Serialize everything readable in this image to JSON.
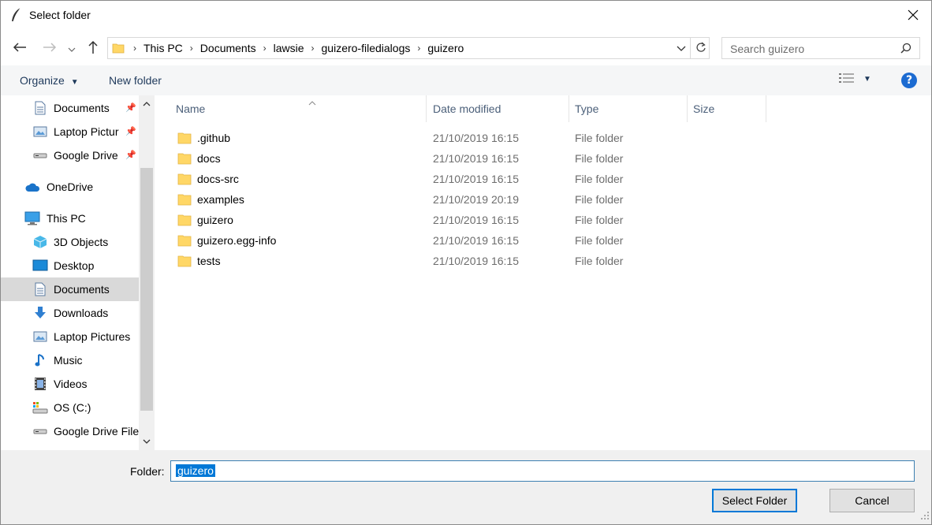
{
  "window": {
    "title": "Select folder",
    "close_glyph": "✕"
  },
  "nav": {
    "breadcrumbs": [
      "This PC",
      "Documents",
      "lawsie",
      "guizero-filedialogs",
      "guizero"
    ],
    "search_placeholder": "Search guizero"
  },
  "toolbar": {
    "organize_label": "Organize",
    "new_folder_label": "New folder",
    "help_label": "?"
  },
  "sidebar": {
    "items": [
      {
        "label": "Documents",
        "icon": "documents-icon",
        "pinned": true
      },
      {
        "label": "Laptop Pictur",
        "icon": "pictures-icon",
        "pinned": true
      },
      {
        "label": "Google Drive",
        "icon": "drive-icon",
        "pinned": true
      },
      {
        "label": "OneDrive",
        "icon": "onedrive-icon"
      },
      {
        "label": "This PC",
        "icon": "this-pc-icon"
      },
      {
        "label": "3D Objects",
        "icon": "3d-objects-icon"
      },
      {
        "label": "Desktop",
        "icon": "desktop-icon"
      },
      {
        "label": "Documents",
        "icon": "documents-icon",
        "selected": true
      },
      {
        "label": "Downloads",
        "icon": "downloads-icon"
      },
      {
        "label": "Laptop Pictures",
        "icon": "pictures-icon"
      },
      {
        "label": "Music",
        "icon": "music-icon"
      },
      {
        "label": "Videos",
        "icon": "videos-icon"
      },
      {
        "label": "OS (C:)",
        "icon": "drive-c-icon"
      },
      {
        "label": "Google Drive File",
        "icon": "drive-icon"
      }
    ]
  },
  "columns": {
    "name": "Name",
    "date": "Date modified",
    "type": "Type",
    "size": "Size"
  },
  "files": [
    {
      "name": ".github",
      "date": "21/10/2019 16:15",
      "type": "File folder"
    },
    {
      "name": "docs",
      "date": "21/10/2019 16:15",
      "type": "File folder"
    },
    {
      "name": "docs-src",
      "date": "21/10/2019 16:15",
      "type": "File folder"
    },
    {
      "name": "examples",
      "date": "21/10/2019 20:19",
      "type": "File folder"
    },
    {
      "name": "guizero",
      "date": "21/10/2019 16:15",
      "type": "File folder"
    },
    {
      "name": "guizero.egg-info",
      "date": "21/10/2019 16:15",
      "type": "File folder"
    },
    {
      "name": "tests",
      "date": "21/10/2019 16:15",
      "type": "File folder"
    }
  ],
  "footer": {
    "folder_label": "Folder:",
    "folder_value": "guizero",
    "select_label": "Select Folder",
    "cancel_label": "Cancel"
  },
  "colors": {
    "accent": "#0078d7",
    "folder": "#ffd766",
    "toolbar_text": "#1e395b"
  }
}
